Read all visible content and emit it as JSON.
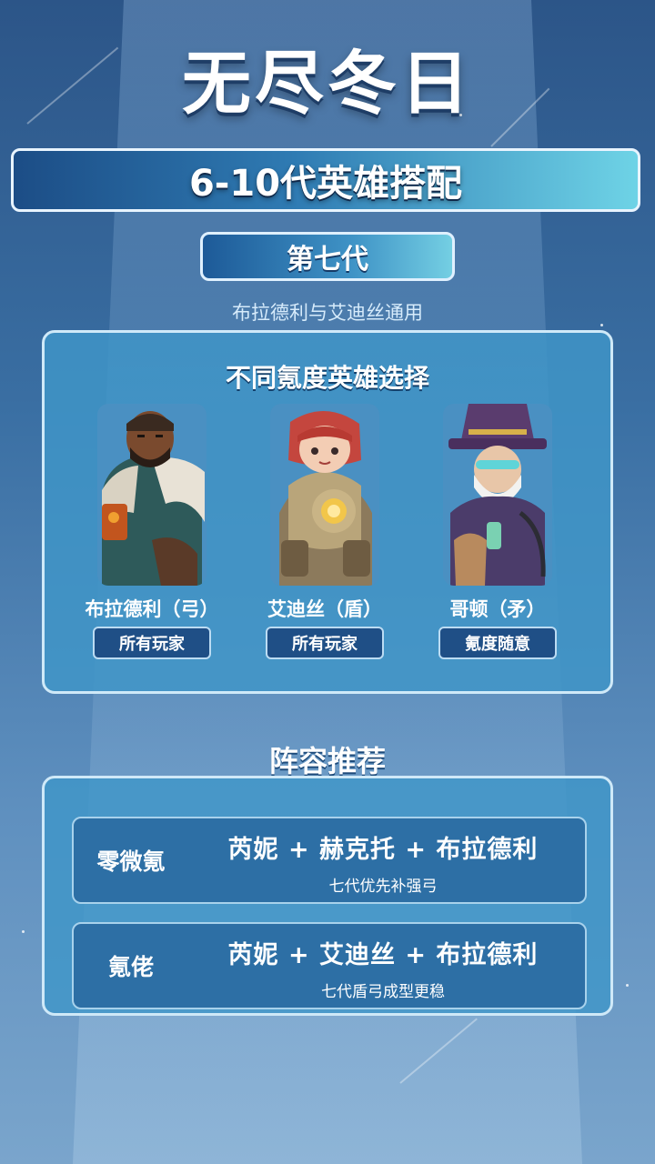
{
  "app_title": "无尽冬日",
  "banner": {
    "title": "6-10代英雄搭配"
  },
  "generation": {
    "label": "第七代",
    "note": "布拉德利与艾迪丝通用"
  },
  "hero_panel": {
    "title": "不同氪度英雄选择",
    "heroes": [
      {
        "name": "布拉德利（弓）",
        "tag": "所有玩家",
        "icon": "bradley-portrait"
      },
      {
        "name": "艾迪丝（盾）",
        "tag": "所有玩家",
        "icon": "edith-portrait"
      },
      {
        "name": "哥顿（矛）",
        "tag": "氪度随意",
        "icon": "gordon-portrait"
      }
    ]
  },
  "lineups": {
    "title": "阵容推荐",
    "items": [
      {
        "label": "零微氪",
        "combo": "芮妮 + 赫克托 + 布拉德利",
        "note": "七代优先补强弓"
      },
      {
        "label": "氪佬",
        "combo": "芮妮 + 艾迪丝 + 布拉德利",
        "note": "七代盾弓成型更稳"
      }
    ]
  },
  "colors": {
    "background_top": "#2c5588",
    "background_bottom": "#7aa5cc",
    "panel": "#4096c8",
    "tag": "#1f4f86",
    "accent_cyan": "#6ed3e6"
  }
}
